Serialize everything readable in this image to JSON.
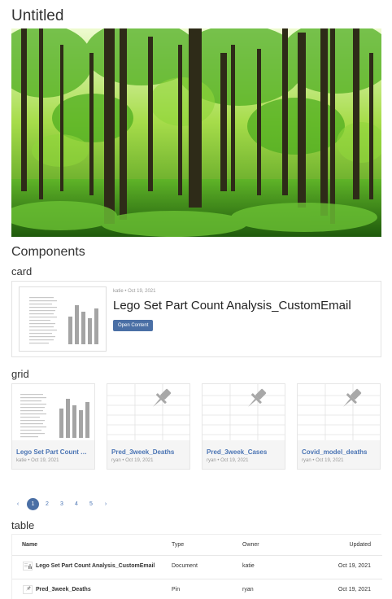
{
  "page": {
    "title": "Untitled"
  },
  "sections": {
    "components": "Components",
    "card": "card",
    "grid": "grid",
    "table": "table"
  },
  "card": {
    "meta": "katie • Oct 19, 2021",
    "title": "Lego Set Part Count Analysis_CustomEmail",
    "button": "Open Content"
  },
  "grid": [
    {
      "name": "Lego Set Part Count Analysis_CustomEmail",
      "meta": "katie • Oct 19, 2021",
      "icon": "report-thumbnail"
    },
    {
      "name": "Pred_3week_Deaths",
      "meta": "ryan • Oct 19, 2021",
      "icon": "pin-icon"
    },
    {
      "name": "Pred_3week_Cases",
      "meta": "ryan • Oct 19, 2021",
      "icon": "pin-icon"
    },
    {
      "name": "Covid_model_deaths",
      "meta": "ryan • Oct 19, 2021",
      "icon": "pin-icon"
    }
  ],
  "pager": {
    "prev": "‹",
    "next": "›",
    "pages": [
      "1",
      "2",
      "3",
      "4",
      "5"
    ],
    "current": "1"
  },
  "table": {
    "columns": [
      "Name",
      "Type",
      "Owner",
      "Updated"
    ],
    "rows": [
      {
        "name": "Lego Set Part Count Analysis_CustomEmail",
        "type": "Document",
        "owner": "katie",
        "updated": "Oct 19, 2021"
      },
      {
        "name": "Pred_3week_Deaths",
        "type": "Pin",
        "owner": "ryan",
        "updated": "Oct 19, 2021"
      }
    ]
  },
  "colors": {
    "accent": "#4a6fa5",
    "link": "#4a74b4"
  }
}
